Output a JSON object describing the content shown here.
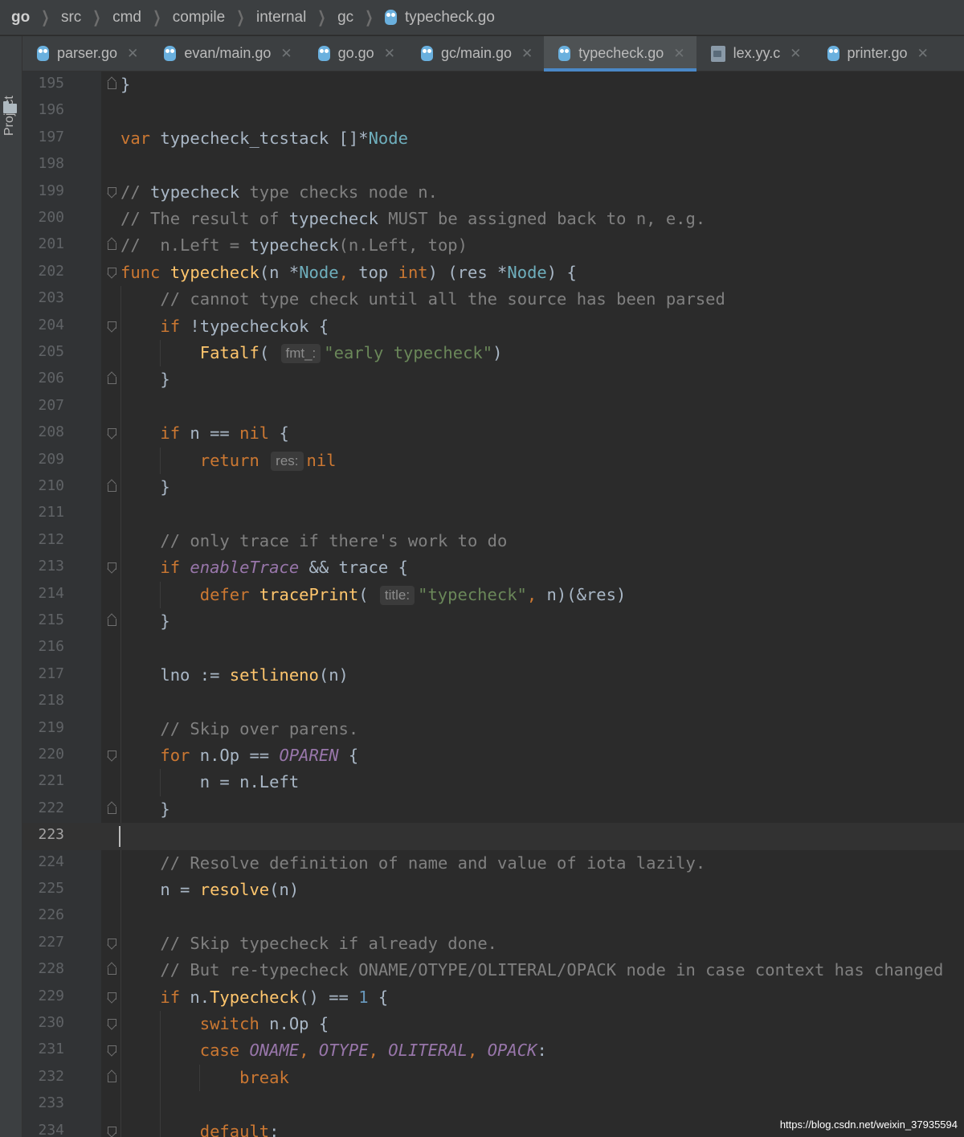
{
  "breadcrumb": {
    "items": [
      "go",
      "src",
      "cmd",
      "compile",
      "internal",
      "gc"
    ],
    "file": "typecheck.go"
  },
  "sidebar": {
    "project_label": "Project"
  },
  "tabs": [
    {
      "label": "parser.go",
      "icon": "go-gopher-icon",
      "active": false
    },
    {
      "label": "evan/main.go",
      "icon": "go-gopher-icon",
      "active": false
    },
    {
      "label": "go.go",
      "icon": "go-gopher-icon",
      "active": false
    },
    {
      "label": "gc/main.go",
      "icon": "go-gopher-icon",
      "active": false
    },
    {
      "label": "typecheck.go",
      "icon": "go-gopher-icon",
      "active": true
    },
    {
      "label": "lex.yy.c",
      "icon": "c-file-icon",
      "active": false
    },
    {
      "label": "printer.go",
      "icon": "go-gopher-icon",
      "active": false
    }
  ],
  "editor": {
    "current_line": "223",
    "lines": [
      {
        "n": "195",
        "fold": "close",
        "ind": 0,
        "html": "}"
      },
      {
        "n": "196",
        "fold": "",
        "ind": 0,
        "html": ""
      },
      {
        "n": "197",
        "fold": "",
        "ind": 0,
        "html": "<span class='kw'>var</span> typecheck_tcstack []*<span class='tp'>Node</span>"
      },
      {
        "n": "198",
        "fold": "",
        "ind": 0,
        "html": ""
      },
      {
        "n": "199",
        "fold": "open",
        "ind": 0,
        "html": "<span class='cm'>// </span><span class='cmbold'>typecheck</span><span class='cm'> type checks node n.</span>"
      },
      {
        "n": "200",
        "fold": "",
        "ind": 0,
        "html": "<span class='cm'>// The result of </span><span class='cmbold'>typecheck</span><span class='cm'> MUST be assigned back to n, e.g.</span>"
      },
      {
        "n": "201",
        "fold": "close",
        "ind": 0,
        "html": "<span class='cm'>//  n.Left = </span><span class='cmbold'>typecheck</span><span class='cm'>(n.Left, top)</span>"
      },
      {
        "n": "202",
        "fold": "open",
        "ind": 0,
        "html": "<span class='kw'>func</span> <span class='fn'>typecheck</span>(n *<span class='tp'>Node</span><span class='kw'>,</span> top <span class='kw'>int</span>) (res *<span class='tp'>Node</span>) {"
      },
      {
        "n": "203",
        "fold": "",
        "ind": 1,
        "html": "    <span class='cm'>// cannot type check until all the source has been parsed</span>"
      },
      {
        "n": "204",
        "fold": "open",
        "ind": 1,
        "html": "    <span class='kw'>if</span> !typecheckok {"
      },
      {
        "n": "205",
        "fold": "",
        "ind": 2,
        "html": "        <span class='fn'>Fatalf</span>( <span class='hint'>fmt_:</span><span class='str'>\"early typecheck\"</span>)"
      },
      {
        "n": "206",
        "fold": "close",
        "ind": 1,
        "html": "    }"
      },
      {
        "n": "207",
        "fold": "",
        "ind": 1,
        "html": ""
      },
      {
        "n": "208",
        "fold": "open",
        "ind": 1,
        "html": "    <span class='kw'>if</span> n == <span class='kw'>nil</span> {"
      },
      {
        "n": "209",
        "fold": "",
        "ind": 2,
        "html": "        <span class='kw'>return</span> <span class='hint'>res:</span><span class='kw'>nil</span>"
      },
      {
        "n": "210",
        "fold": "close",
        "ind": 1,
        "html": "    }"
      },
      {
        "n": "211",
        "fold": "",
        "ind": 1,
        "html": ""
      },
      {
        "n": "212",
        "fold": "",
        "ind": 1,
        "html": "    <span class='cm'>// only trace if there's work to do</span>"
      },
      {
        "n": "213",
        "fold": "open",
        "ind": 1,
        "html": "    <span class='kw'>if</span> <span class='const'>enableTrace</span> &amp;&amp; trace {"
      },
      {
        "n": "214",
        "fold": "",
        "ind": 2,
        "html": "        <span class='kw'>defer</span> <span class='fn'>tracePrint</span>( <span class='hint'>title:</span><span class='str'>\"typecheck\"</span><span class='kw'>,</span> n)(&amp;res)"
      },
      {
        "n": "215",
        "fold": "close",
        "ind": 1,
        "html": "    }"
      },
      {
        "n": "216",
        "fold": "",
        "ind": 1,
        "html": ""
      },
      {
        "n": "217",
        "fold": "",
        "ind": 1,
        "html": "    lno := <span class='fn'>setlineno</span>(n)"
      },
      {
        "n": "218",
        "fold": "",
        "ind": 1,
        "html": ""
      },
      {
        "n": "219",
        "fold": "",
        "ind": 1,
        "html": "    <span class='cm'>// Skip over parens.</span>"
      },
      {
        "n": "220",
        "fold": "open",
        "ind": 1,
        "html": "    <span class='kw'>for</span> n.Op == <span class='const'>OPAREN</span> {"
      },
      {
        "n": "221",
        "fold": "",
        "ind": 2,
        "html": "        n = n.Left"
      },
      {
        "n": "222",
        "fold": "close",
        "ind": 1,
        "html": "    }"
      },
      {
        "n": "223",
        "fold": "",
        "ind": 0,
        "html": ""
      },
      {
        "n": "224",
        "fold": "",
        "ind": 1,
        "html": "    <span class='cm'>// Resolve definition of name and value of iota lazily.</span>"
      },
      {
        "n": "225",
        "fold": "",
        "ind": 1,
        "html": "    n = <span class='fn'>resolve</span>(n)"
      },
      {
        "n": "226",
        "fold": "",
        "ind": 1,
        "html": ""
      },
      {
        "n": "227",
        "fold": "open",
        "ind": 1,
        "html": "    <span class='cm'>// Skip typecheck if already done.</span>"
      },
      {
        "n": "228",
        "fold": "close",
        "ind": 1,
        "html": "    <span class='cm'>// But re-typecheck ONAME/OTYPE/OLITERAL/OPACK node in case context has changed</span>"
      },
      {
        "n": "229",
        "fold": "open",
        "ind": 1,
        "html": "    <span class='kw'>if</span> n.<span class='fn'>Typecheck</span>() == <span class='num'>1</span> {"
      },
      {
        "n": "230",
        "fold": "open",
        "ind": 2,
        "html": "        <span class='kw'>switch</span> n.Op {"
      },
      {
        "n": "231",
        "fold": "open",
        "ind": 2,
        "html": "        <span class='kw'>case</span> <span class='const'>ONAME</span><span class='kw'>,</span> <span class='const'>OTYPE</span><span class='kw'>,</span> <span class='const'>OLITERAL</span><span class='kw'>,</span> <span class='const'>OPACK</span>:"
      },
      {
        "n": "232",
        "fold": "close",
        "ind": 3,
        "html": "            <span class='kw'>break</span>"
      },
      {
        "n": "233",
        "fold": "",
        "ind": 2,
        "html": ""
      },
      {
        "n": "234",
        "fold": "open",
        "ind": 2,
        "html": "        <span class='kw'>default</span>:"
      }
    ]
  },
  "watermark": "https://blog.csdn.net/weixin_37935594"
}
